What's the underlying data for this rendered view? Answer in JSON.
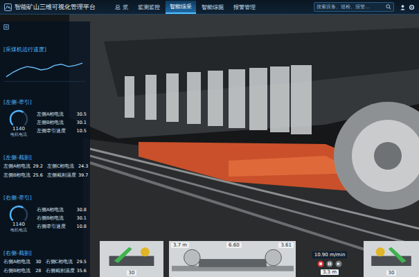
{
  "header": {
    "title": "智能矿山三维可视化管理平台",
    "tabs": [
      {
        "label": "总 览",
        "selected": false
      },
      {
        "label": "监测监控",
        "selected": false
      },
      {
        "label": "智能综采",
        "selected": true
      },
      {
        "label": "智能综掘",
        "selected": false
      },
      {
        "label": "报警管理",
        "selected": false
      }
    ],
    "search": {
      "placeholder": "搜索设备、巡检、报警…"
    }
  },
  "speed_chart": {
    "title": "[采煤机运行速度]",
    "series": [
      5.2,
      5.6,
      5.9,
      6.1,
      6.0,
      5.8,
      5.9,
      6.2,
      6.3,
      6.1,
      6.2,
      6.4
    ]
  },
  "sections": [
    {
      "title": "[左侧-牵引]",
      "kind": "gauge",
      "gauge": {
        "value": "1140",
        "label": "电机电流",
        "level": 0.62
      },
      "readings": [
        {
          "label": "左侧A相电流",
          "value": "30.5"
        },
        {
          "label": "左侧B相电流",
          "value": "30.1"
        },
        {
          "label": "左侧牵引速度",
          "value": "10.5"
        }
      ]
    },
    {
      "title": "[左侧-截割]",
      "kind": "grid",
      "readings": [
        {
          "label": "左侧A相电流",
          "value": "29.2"
        },
        {
          "label": "左侧C相电流",
          "value": "24.3"
        },
        {
          "label": "左侧B相电流",
          "value": "25.6"
        },
        {
          "label": "左侧截割温度",
          "value": "39.7"
        }
      ]
    },
    {
      "title": "[右侧-牵引]",
      "kind": "gauge",
      "gauge": {
        "value": "1140",
        "label": "电机电流",
        "level": 0.62
      },
      "readings": [
        {
          "label": "右侧A相电流",
          "value": "30.8"
        },
        {
          "label": "右侧B相电流",
          "value": "30.1"
        },
        {
          "label": "右侧牵引速度",
          "value": "10.8"
        }
      ]
    },
    {
      "title": "[右侧-截割]",
      "kind": "grid",
      "readings": [
        {
          "label": "右侧A相电流",
          "value": "30"
        },
        {
          "label": "右侧C相电流",
          "value": "29.5"
        },
        {
          "label": "右侧B相电流",
          "value": "28"
        },
        {
          "label": "右侧截割温度",
          "value": "35.6"
        }
      ]
    }
  ],
  "bottom": {
    "left_arm": {
      "angle": "30"
    },
    "shearer": {
      "left_height": "6.60",
      "right_height": "3.61",
      "left_depth": "3.7 m",
      "right_depth": "3.3 m"
    },
    "speed": "10.90 m/min",
    "right_arm": {
      "angle": "30"
    }
  }
}
